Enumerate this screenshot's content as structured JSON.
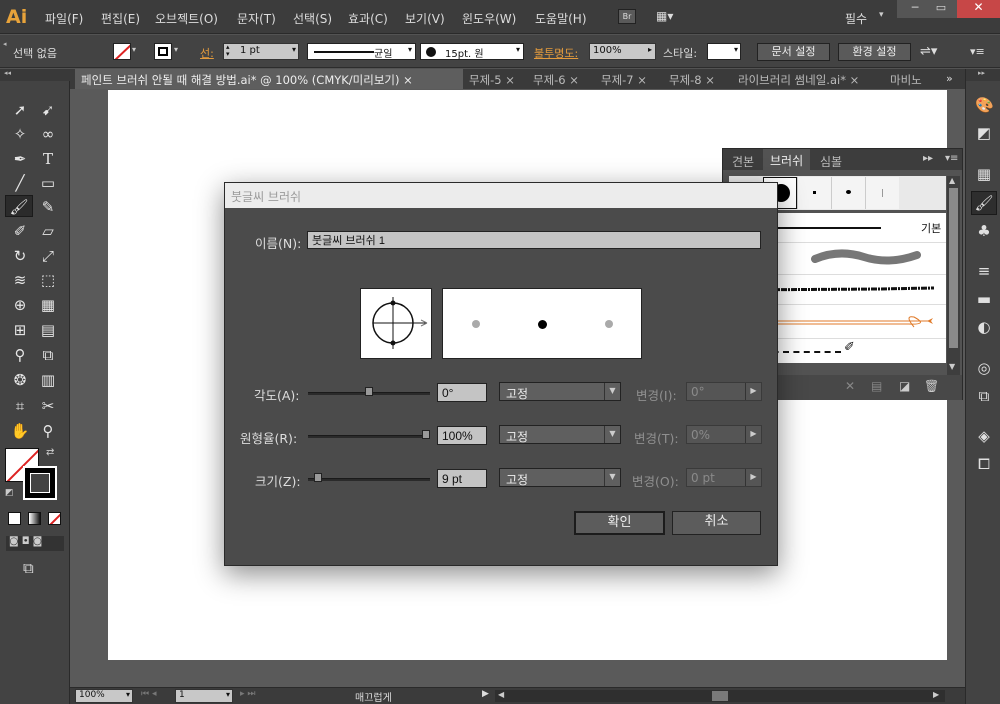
{
  "app": {
    "logo": "Ai",
    "workspace": "필수"
  },
  "menu": [
    "파일(F)",
    "편집(E)",
    "오브젝트(O)",
    "문자(T)",
    "선택(S)",
    "효과(C)",
    "보기(V)",
    "윈도우(W)",
    "도움말(H)"
  ],
  "bridge_label": "Br",
  "control": {
    "selection": "선택 없음",
    "stroke_label": "선:",
    "stroke_weight": "1 pt",
    "profile": "균일",
    "brush": "15pt. 원",
    "opacity_label": "불투명도:",
    "opacity": "100%",
    "style_label": "스타일:",
    "doc_setup": "문서 설정",
    "preferences": "환경 설정"
  },
  "tabs": [
    "페인트 브러쉬 안될 때 해결 방법.ai* @ 100% (CMYK/미리보기)",
    "무제-5",
    "무제-6",
    "무제-7",
    "무제-8",
    "라이브러리 썸네일.ai*",
    "마비노"
  ],
  "brush_panel": {
    "tabs": [
      "견본",
      "브러쉬",
      "심볼"
    ],
    "basic_label": "기본",
    "colors": {
      "accent_stroke": "#e07a28"
    }
  },
  "dialog": {
    "title": "붓글씨 브러쉬",
    "name_label": "이름(N):",
    "name_value": "붓글씨 브러쉬 1",
    "rows": [
      {
        "label": "각도(A):",
        "value": "0°",
        "mode": "고정",
        "var_label": "변경(I):",
        "var_value": "0°",
        "knob": 0.5
      },
      {
        "label": "원형율(R):",
        "value": "100%",
        "mode": "고정",
        "var_label": "변경(T):",
        "var_value": "0%",
        "knob": 1.0
      },
      {
        "label": "크기(Z):",
        "value": "9 pt",
        "mode": "고정",
        "var_label": "변경(O):",
        "var_value": "0 pt",
        "knob": 0.05
      }
    ],
    "ok": "확인",
    "cancel": "취소"
  },
  "status": {
    "zoom": "100%",
    "page": "1",
    "mode": "매끄럽게"
  }
}
